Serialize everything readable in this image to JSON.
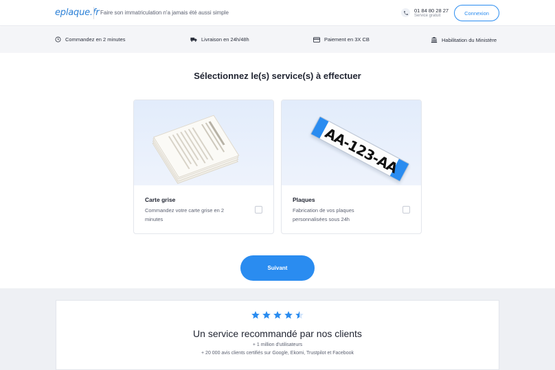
{
  "header": {
    "logo": "eplaque.fr",
    "tagline": "Faire son immatriculation n'a jamais été aussi simple",
    "phone": "01 84 80 28 27",
    "phone_note": "Service gratuit",
    "login_label": "Connexion"
  },
  "features": [
    {
      "icon": "clock-icon",
      "label": "Commandez en 2 minutes"
    },
    {
      "icon": "truck-icon",
      "label": "Livraison en 24h/48h"
    },
    {
      "icon": "credit-card-icon",
      "label": "Paiement en 3X CB"
    },
    {
      "icon": "bank-icon",
      "label": "Habilitation du Ministère"
    }
  ],
  "main": {
    "title": "Sélectionnez le(s) service(s) à effectuer",
    "cards": [
      {
        "title": "Carte grise",
        "description": "Commandez votre carte grise en 2 minutes",
        "checked": false
      },
      {
        "title": "Plaques",
        "description": "Fabrication de vos plaques personnalisées sous 24h",
        "checked": false
      }
    ],
    "plate_text": "AA-123-AA",
    "next_label": "Suivant"
  },
  "reviews": {
    "rating": 4.5,
    "max_rating": 5,
    "title": "Un service recommandé par nos clients",
    "line1": "+ 1 million d'utilisateurs",
    "line2": "+ 20 000 avis clients certifiés sur Google, Ekomi, Trustpilot et Facebook"
  },
  "colors": {
    "accent": "#2a8cf0",
    "star": "#2a8cf0",
    "featurebar_bg": "#f4f5f8"
  }
}
